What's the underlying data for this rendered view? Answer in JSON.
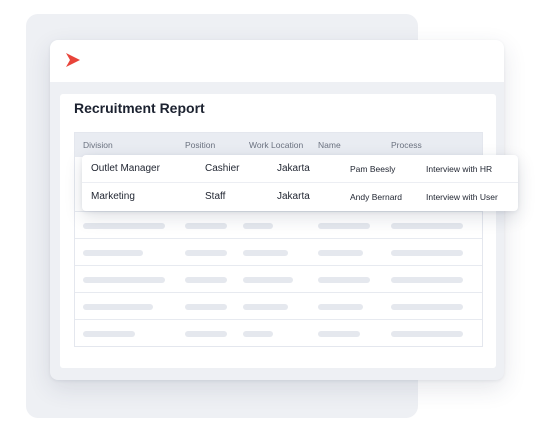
{
  "app": {
    "brand_color": "#e8443a"
  },
  "report": {
    "title": "Recruitment Report",
    "columns": [
      "Division",
      "Position",
      "Work Location",
      "Name",
      "Process"
    ],
    "rows": [
      {
        "division": "Outlet Manager",
        "position": "Cashier",
        "location": "Jakarta",
        "name": "Pam Beesly",
        "process": "Interview with HR"
      },
      {
        "division": "Marketing",
        "position": "Staff",
        "location": "Jakarta",
        "name": "Andy Bernard",
        "process": "Interview with User"
      }
    ]
  }
}
